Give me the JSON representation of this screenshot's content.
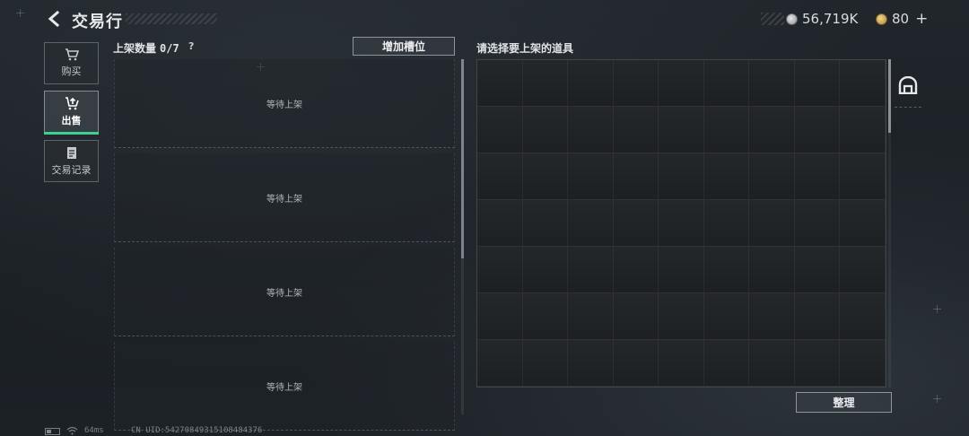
{
  "header": {
    "title": "交易行",
    "currencies": [
      {
        "icon": "silver-coin-icon",
        "amount": "56,719K"
      },
      {
        "icon": "gold-coin-icon",
        "amount": "80"
      }
    ],
    "add_symbol": "+"
  },
  "sidebar": {
    "tabs": [
      {
        "label": "购买",
        "icon": "cart-icon",
        "active": false
      },
      {
        "label": "出售",
        "icon": "sell-cart-icon",
        "active": true
      },
      {
        "label": "交易记录",
        "icon": "document-icon",
        "active": false
      }
    ]
  },
  "listing": {
    "header_label": "上架数量",
    "count": "0/7",
    "help_symbol": "?",
    "add_slot_label": "增加槽位",
    "slots": [
      {
        "label": "等待上架"
      },
      {
        "label": "等待上架"
      },
      {
        "label": "等待上架"
      },
      {
        "label": "等待上架"
      }
    ]
  },
  "inventory": {
    "title": "请选择要上架的道具",
    "sort_label": "整理"
  },
  "status_bar": {
    "ping": "64ms",
    "uid": "CN UID:54270849315108484376"
  },
  "colors": {
    "active_tab_accent": "#3fcf8e",
    "background": "#1b2025"
  }
}
